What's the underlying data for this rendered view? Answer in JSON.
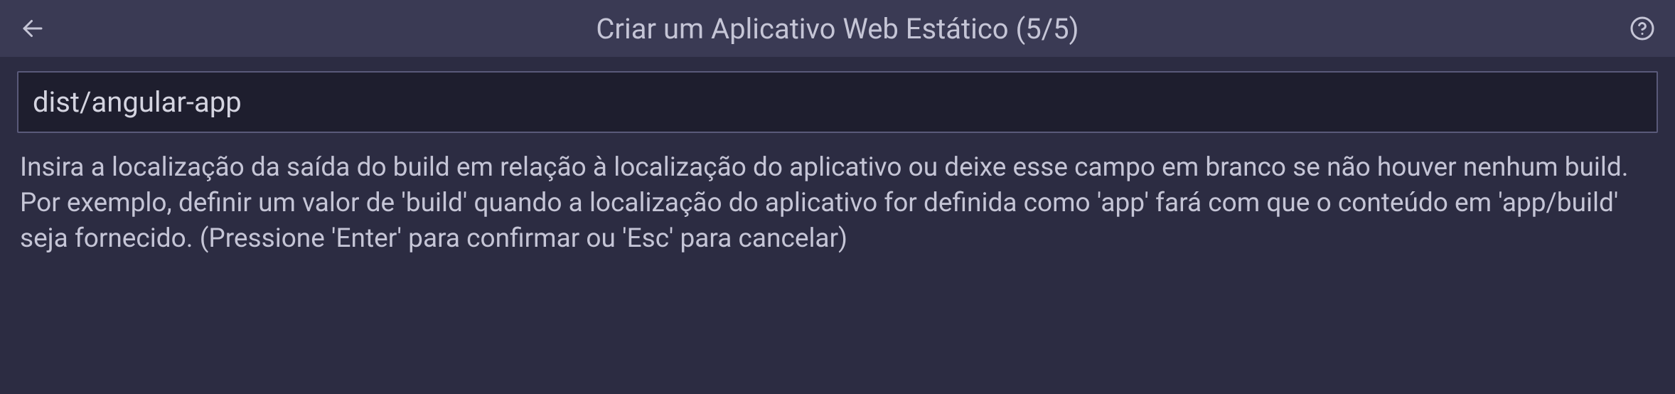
{
  "header": {
    "title": "Criar um Aplicativo Web Estático (5/5)"
  },
  "input": {
    "value": "dist/angular-app"
  },
  "helpText": "Insira a localização da saída do build em relação à localização do aplicativo ou deixe esse campo em branco se não houver nenhum build. Por exemplo, definir um valor de 'build' quando a localização do aplicativo for definida como 'app' fará com que o conteúdo em 'app/build' seja fornecido. (Pressione 'Enter' para confirmar ou 'Esc' para cancelar)"
}
